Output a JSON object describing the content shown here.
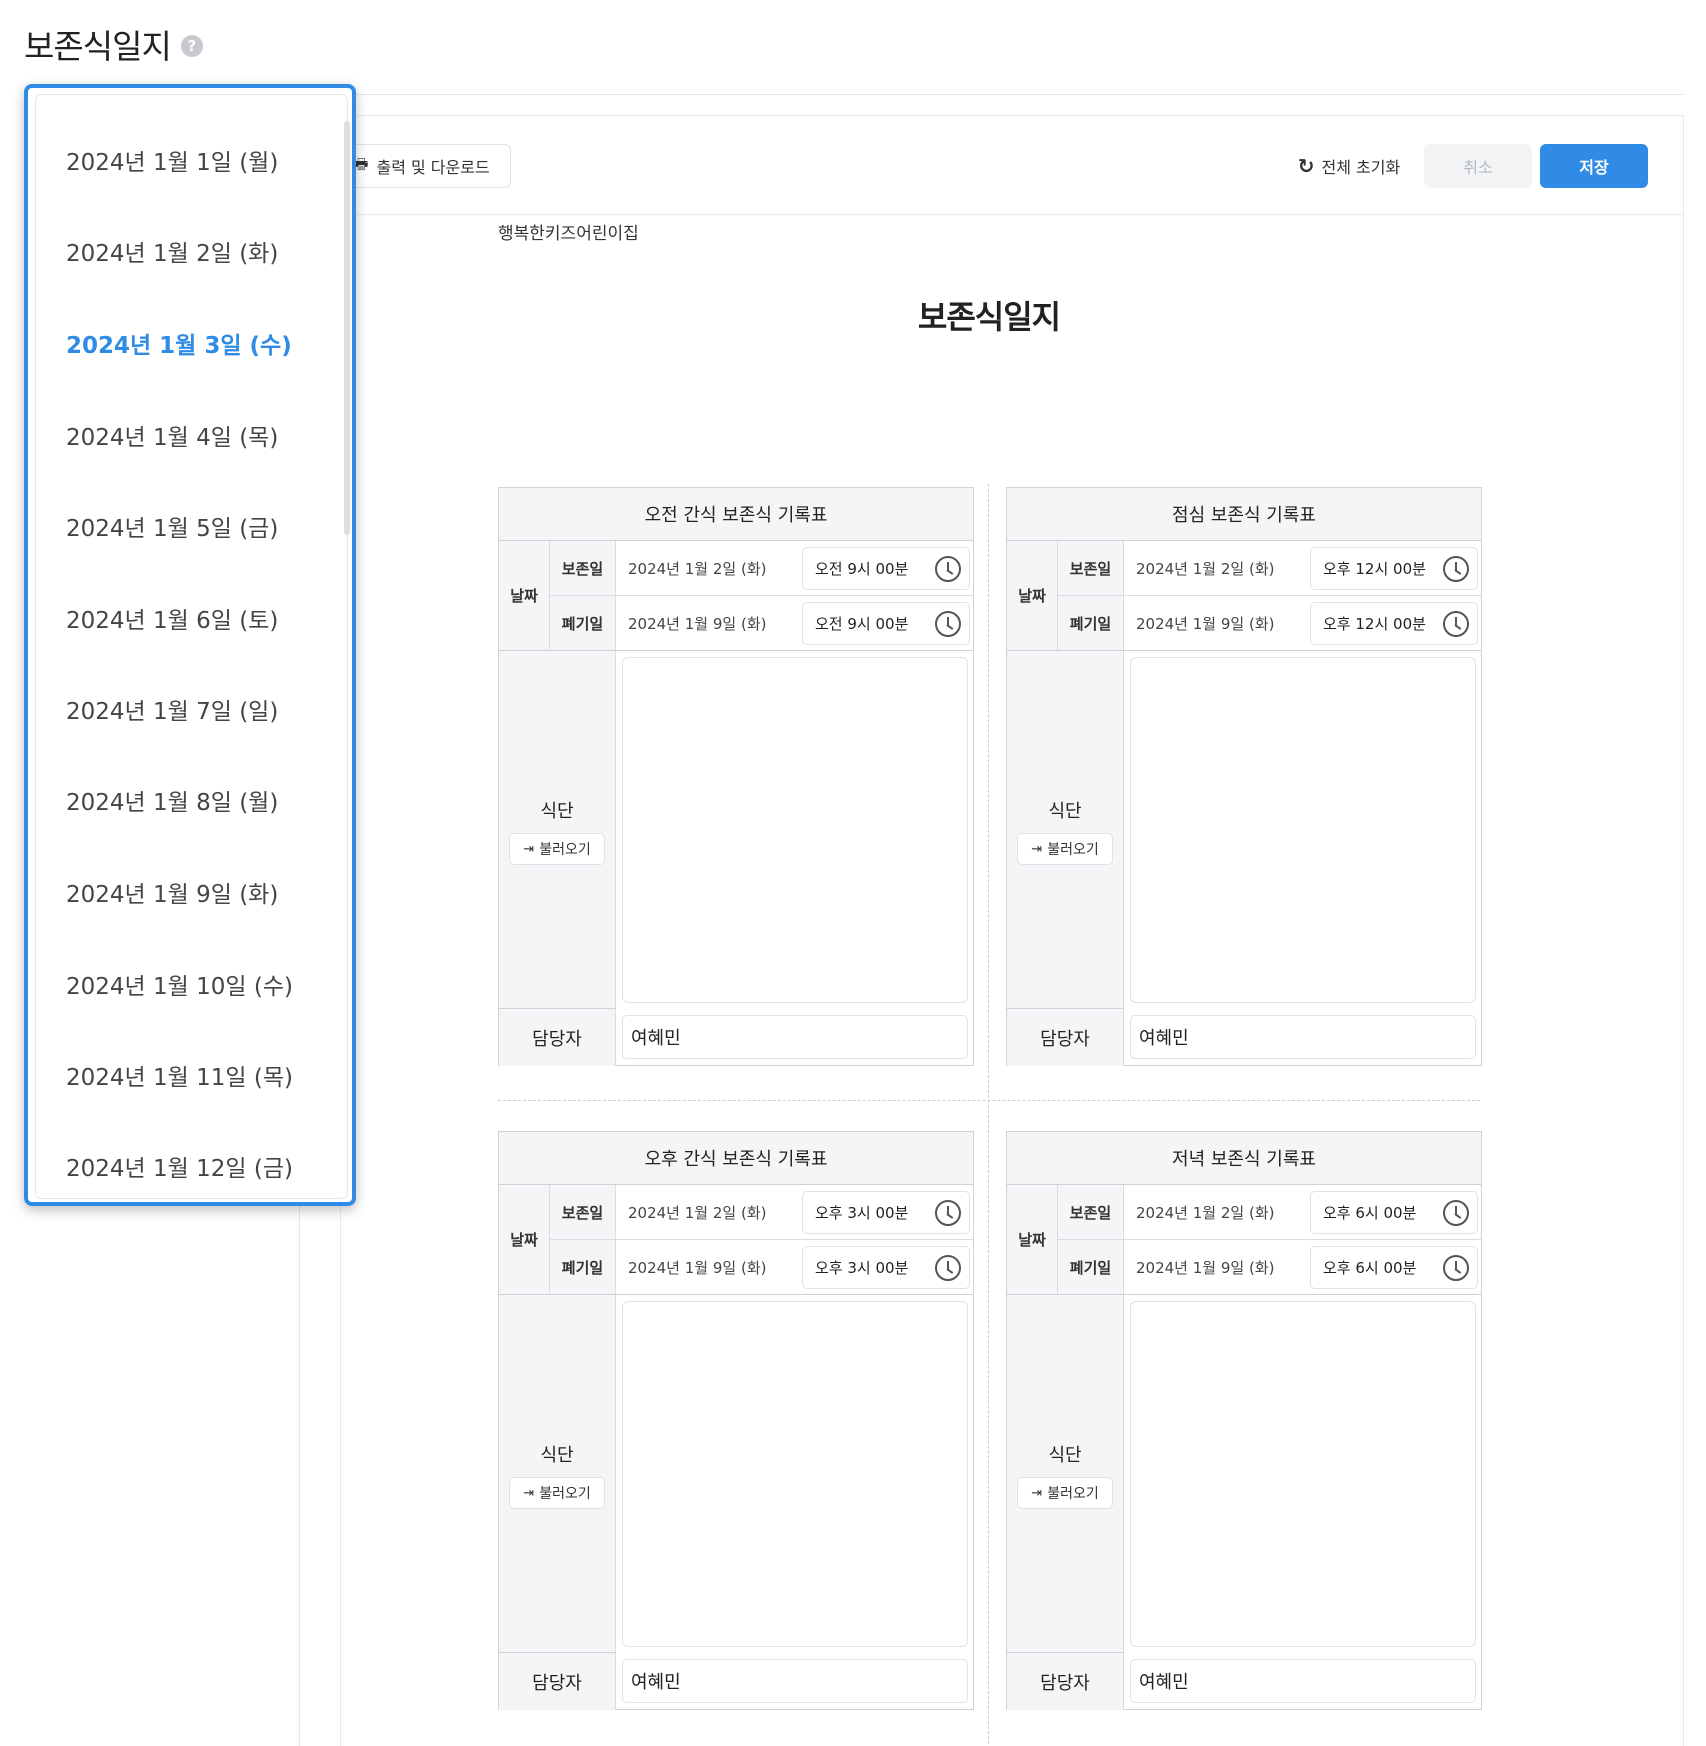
{
  "page": {
    "title": "보존식일지",
    "help_icon": "question-circle-icon"
  },
  "toolbar": {
    "print_label": "출력 및 다운로드",
    "reset_label": "전체 초기화",
    "cancel_label": "취소",
    "save_label": "저장"
  },
  "document": {
    "org_name": "행복한키즈어린이집",
    "title": "보존식일지"
  },
  "labels": {
    "date": "날짜",
    "keep_date": "보존일",
    "discard_date": "폐기일",
    "menu": "식단",
    "load": "불러오기",
    "manager": "담당자"
  },
  "cards": [
    {
      "title": "오전 간식 보존식 기록표",
      "keep_date": "2024년 1월 2일 (화)",
      "keep_time": "오전 9시 00분",
      "discard_date": "2024년 1월 9일 (화)",
      "discard_time": "오전 9시 00분",
      "menu": "",
      "manager": "여혜민"
    },
    {
      "title": "점심 보존식 기록표",
      "keep_date": "2024년 1월 2일 (화)",
      "keep_time": "오후 12시 00분",
      "discard_date": "2024년 1월 9일 (화)",
      "discard_time": "오후 12시 00분",
      "menu": "",
      "manager": "여혜민"
    },
    {
      "title": "오후 간식 보존식 기록표",
      "keep_date": "2024년 1월 2일 (화)",
      "keep_time": "오후 3시 00분",
      "discard_date": "2024년 1월 9일 (화)",
      "discard_time": "오후 3시 00분",
      "menu": "",
      "manager": "여혜민"
    },
    {
      "title": "저녁 보존식 기록표",
      "keep_date": "2024년 1월 2일 (화)",
      "keep_time": "오후 6시 00분",
      "discard_date": "2024년 1월 9일 (화)",
      "discard_time": "오후 6시 00분",
      "menu": "",
      "manager": "여혜민"
    }
  ],
  "date_dropdown": {
    "selected_index": 2,
    "items": [
      "2024년 1월 1일 (월)",
      "2024년 1월 2일 (화)",
      "2024년 1월 3일 (수)",
      "2024년 1월 4일 (목)",
      "2024년 1월 5일 (금)",
      "2024년 1월 6일 (토)",
      "2024년 1월 7일 (일)",
      "2024년 1월 8일 (월)",
      "2024년 1월 9일 (화)",
      "2024년 1월 10일 (수)",
      "2024년 1월 11일 (목)",
      "2024년 1월 12일 (금)"
    ]
  },
  "colors": {
    "accent": "#2f8be6",
    "disabled_text": "#b6bbc1"
  }
}
